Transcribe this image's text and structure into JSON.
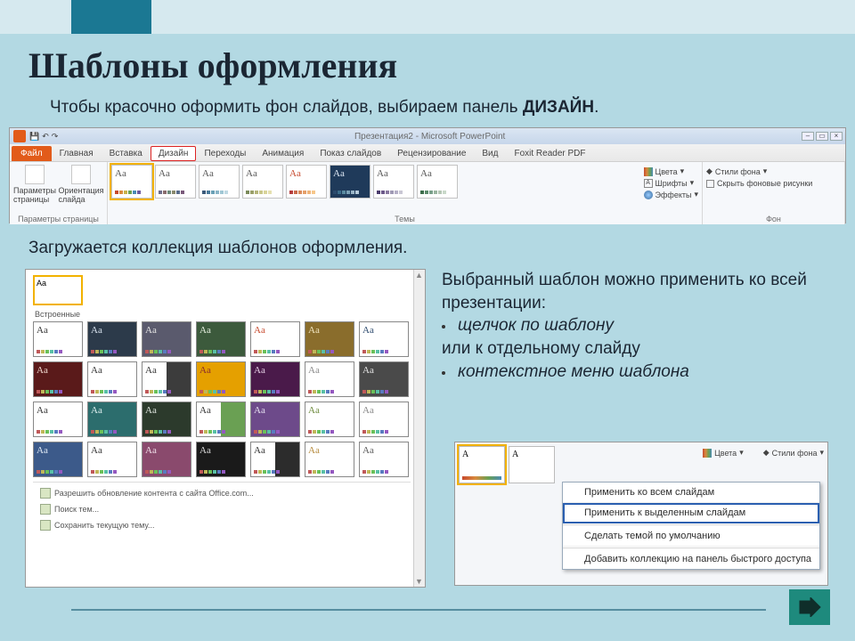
{
  "slide": {
    "title": "Шаблоны оформления",
    "intro_plain": "Чтобы красочно оформить фон слайдов, выбираем панель ",
    "intro_bold": "ДИЗАЙН",
    "intro_dot": ".",
    "mid": "Загружается коллекция шаблонов оформления.",
    "right": {
      "l1": "Выбранный шаблон можно применить ко всей презентации:",
      "b1": "щелчок по шаблону",
      "l2": "или к отдельному слайду",
      "b2": "контекстное меню шаблона"
    }
  },
  "ribbon": {
    "window_title": "Презентация2 - Microsoft PowerPoint",
    "tabs": {
      "file": "Файл",
      "home": "Главная",
      "insert": "Вставка",
      "design": "Дизайн",
      "transitions": "Переходы",
      "animation": "Анимация",
      "slideshow": "Показ слайдов",
      "review": "Рецензирование",
      "view": "Вид",
      "foxit": "Foxit Reader PDF"
    },
    "groups": {
      "page_setup": {
        "label": "Параметры страницы",
        "btn1": "Параметры страницы",
        "btn2": "Ориентация слайда"
      },
      "themes": {
        "label": "Темы",
        "aa": "Aa",
        "colors": "Цвета",
        "fonts": "Шрифты",
        "effects": "Эффекты"
      },
      "background": {
        "label": "Фон",
        "styles": "Стили фона",
        "hide": "Скрыть фоновые рисунки"
      }
    },
    "theme_colors": [
      [
        "#c74a2e",
        "#d98a3e",
        "#c9b24a",
        "#6aa053",
        "#4a8bb5",
        "#6d5aa0"
      ],
      [
        "#6d6d8a",
        "#8a6d6d",
        "#6d8a7a",
        "#8a8a6d",
        "#5a6d8a",
        "#7a5a7a"
      ],
      [
        "#3c5a7a",
        "#4a7a9a",
        "#6aa0b5",
        "#8ab5c7",
        "#a0c7d4",
        "#c0d9e3"
      ],
      [
        "#7a8a5a",
        "#9aa06a",
        "#b5b57a",
        "#c9c78a",
        "#d9d49a",
        "#e5e0b0"
      ],
      [
        "#b53c3c",
        "#c96a4a",
        "#d98a5a",
        "#e5a06a",
        "#f0b57a",
        "#f7c78a"
      ],
      [
        "#2c4a6d",
        "#3c6d8a",
        "#5a8aa0",
        "#7aa0b5",
        "#9ab5c7",
        "#b5c9d9"
      ],
      [
        "#4a3c6d",
        "#6d5a8a",
        "#8a7aa0",
        "#a09ab5",
        "#b5b0c7",
        "#c9c7d4"
      ],
      [
        "#3c6d4a",
        "#5a8a6a",
        "#7aa08a",
        "#9ab5a0",
        "#b5c7b5",
        "#c9d9c9"
      ]
    ]
  },
  "gallery": {
    "section_builtin": "Встроенные",
    "aa": "Aa",
    "link1": "Разрешить обновление контента с сайта Office.com...",
    "link2": "Поиск тем...",
    "link3": "Сохранить текущую тему...",
    "rows": [
      [
        {
          "bg": "#ffffff",
          "fg": "#333"
        },
        {
          "bg": "#2c3a4a",
          "fg": "#d9e3ef"
        },
        {
          "bg": "#5a5a6d",
          "fg": "#e5e5e5"
        },
        {
          "bg": "#3c5a3c",
          "fg": "#e5efdf"
        },
        {
          "bg": "#ffffff",
          "fg": "#c74a2e"
        },
        {
          "bg": "#8a6d2c",
          "fg": "#f0e5c0"
        },
        {
          "bg": "#ffffff",
          "fg": "#2c4a6d"
        }
      ],
      [
        {
          "bg": "#5a1a1a",
          "fg": "#f0d9d0"
        },
        {
          "bg": "#ffffff",
          "fg": "#333"
        },
        {
          "bg": "#ffffff",
          "fg": "#333",
          "half": "#3c3c3c"
        },
        {
          "bg": "#e5a000",
          "fg": "#8a2c2c"
        },
        {
          "bg": "#4a1a4a",
          "fg": "#e5d0e5"
        },
        {
          "bg": "#ffffff",
          "fg": "#8a8a8a"
        },
        {
          "bg": "#4a4a4a",
          "fg": "#e5e5e5"
        }
      ],
      [
        {
          "bg": "#ffffff",
          "fg": "#333"
        },
        {
          "bg": "#2c6d6d",
          "fg": "#dff0f0"
        },
        {
          "bg": "#2c3a2c",
          "fg": "#dfe5df"
        },
        {
          "bg": "#ffffff",
          "fg": "#333",
          "half": "#6aa053"
        },
        {
          "bg": "#6d4a8a",
          "fg": "#e5dff0"
        },
        {
          "bg": "#ffffff",
          "fg": "#6d8a3c"
        },
        {
          "bg": "#ffffff",
          "fg": "#888"
        }
      ],
      [
        {
          "bg": "#3c5a8a",
          "fg": "#dfe9f5"
        },
        {
          "bg": "#ffffff",
          "fg": "#333"
        },
        {
          "bg": "#8a4a6d",
          "fg": "#f0dfe9"
        },
        {
          "bg": "#1a1a1a",
          "fg": "#d9d9d9"
        },
        {
          "bg": "#ffffff",
          "fg": "#333",
          "half": "#2c2c2c"
        },
        {
          "bg": "#ffffff",
          "fg": "#b58a3c"
        },
        {
          "bg": "#ffffff",
          "fg": "#5a5a5a"
        }
      ]
    ]
  },
  "context": {
    "colors": "Цвета",
    "styles": "Стили фона",
    "items": {
      "m1": "Применить ко всем слайдам",
      "m2": "Применить к выделенным слайдам",
      "m3": "Сделать темой по умолчанию",
      "m4": "Добавить коллекцию на панель быстрого доступа"
    }
  }
}
